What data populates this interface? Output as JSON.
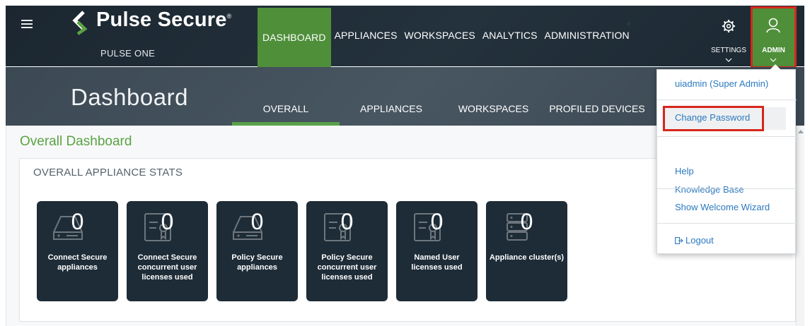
{
  "header": {
    "brand": "Pulse Secure",
    "brand_mark": "®",
    "product": "PULSE ONE",
    "nav": [
      "DASHBOARD",
      "APPLIANCES",
      "WORKSPACES",
      "ANALYTICS",
      "ADMINISTRATION"
    ],
    "settings_label": "SETTINGS",
    "admin_label": "ADMIN"
  },
  "subheader": {
    "title": "Dashboard",
    "tabs": [
      "OVERALL",
      "APPLIANCES",
      "WORKSPACES",
      "PROFILED DEVICES"
    ]
  },
  "main": {
    "section_title": "Overall Dashboard",
    "panel_title": "OVERALL APPLIANCE STATS",
    "tiles": [
      {
        "value": "0",
        "label": "Connect Secure appliances",
        "icon": "appliance-icon"
      },
      {
        "value": "0",
        "label": "Connect Secure concurrent user licenses used",
        "icon": "certificate-icon"
      },
      {
        "value": "0",
        "label": "Policy Secure appliances",
        "icon": "appliance-icon"
      },
      {
        "value": "0",
        "label": "Policy Secure concurrent user licenses used",
        "icon": "certificate-icon"
      },
      {
        "value": "0",
        "label": "Named User licenses used",
        "icon": "certificate-icon"
      },
      {
        "value": "0",
        "label": "Appliance cluster(s)",
        "icon": "cluster-icon"
      }
    ]
  },
  "admin_menu": {
    "user": "uiadmin (Super Admin)",
    "change_password": "Change Password",
    "help": "Help",
    "knowledge_base": "Knowledge Base",
    "welcome_wizard": "Show Welcome Wizard",
    "logout": "Logout"
  },
  "colors": {
    "nav_bg": "#1e2a33",
    "accent_green": "#4f8f3a",
    "highlight_red": "#d7271c",
    "link_blue": "#2b79bf",
    "tile_bg": "#1e2c37"
  }
}
